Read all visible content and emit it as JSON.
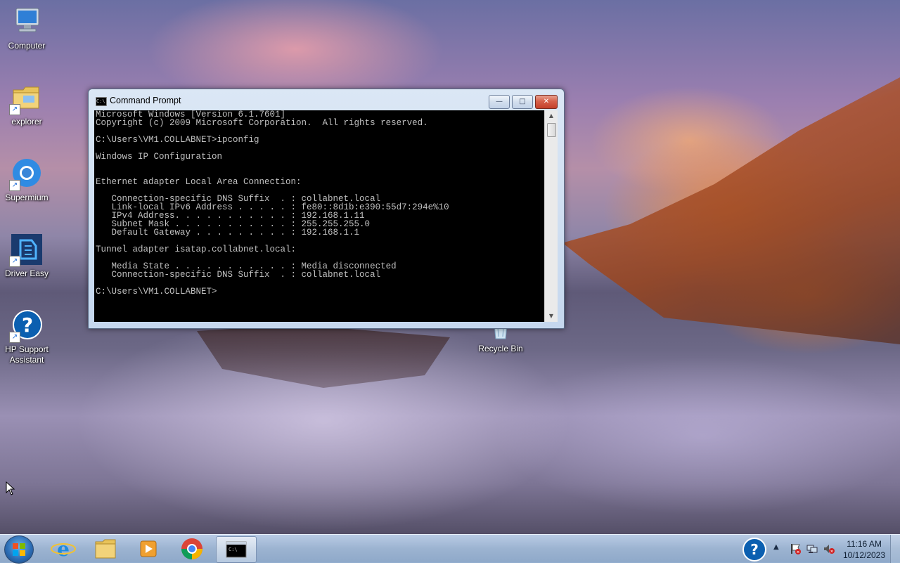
{
  "desktop": {
    "icons": [
      {
        "label": "Computer"
      },
      {
        "label": "explorer"
      },
      {
        "label": "Supermium"
      },
      {
        "label": "Driver Easy"
      },
      {
        "label": "HP Support Assistant"
      },
      {
        "label": "Recycle Bin"
      }
    ]
  },
  "cmd": {
    "title": "Command Prompt",
    "minimize_glyph": "—",
    "maximize_glyph": "□",
    "close_glyph": "✕",
    "title_icon_text": "C:\\",
    "output": "Microsoft Windows [Version 6.1.7601]\nCopyright (c) 2009 Microsoft Corporation.  All rights reserved.\n\nC:\\Users\\VM1.COLLABNET>ipconfig\n\nWindows IP Configuration\n\n\nEthernet adapter Local Area Connection:\n\n   Connection-specific DNS Suffix  . : collabnet.local\n   Link-local IPv6 Address . . . . . : fe80::8d1b:e390:55d7:294e%10\n   IPv4 Address. . . . . . . . . . . : 192.168.1.11\n   Subnet Mask . . . . . . . . . . . : 255.255.255.0\n   Default Gateway . . . . . . . . . : 192.168.1.1\n\nTunnel adapter isatap.collabnet.local:\n\n   Media State . . . . . . . . . . . : Media disconnected\n   Connection-specific DNS Suffix  . : collabnet.local\n\nC:\\Users\\VM1.COLLABNET>"
  },
  "taskbar": {
    "help_glyph": "?",
    "tray_chevron": "▲",
    "cmd_button_text": "C:\\",
    "clock": {
      "time": "11:16 AM",
      "date": "10/12/2023"
    }
  }
}
